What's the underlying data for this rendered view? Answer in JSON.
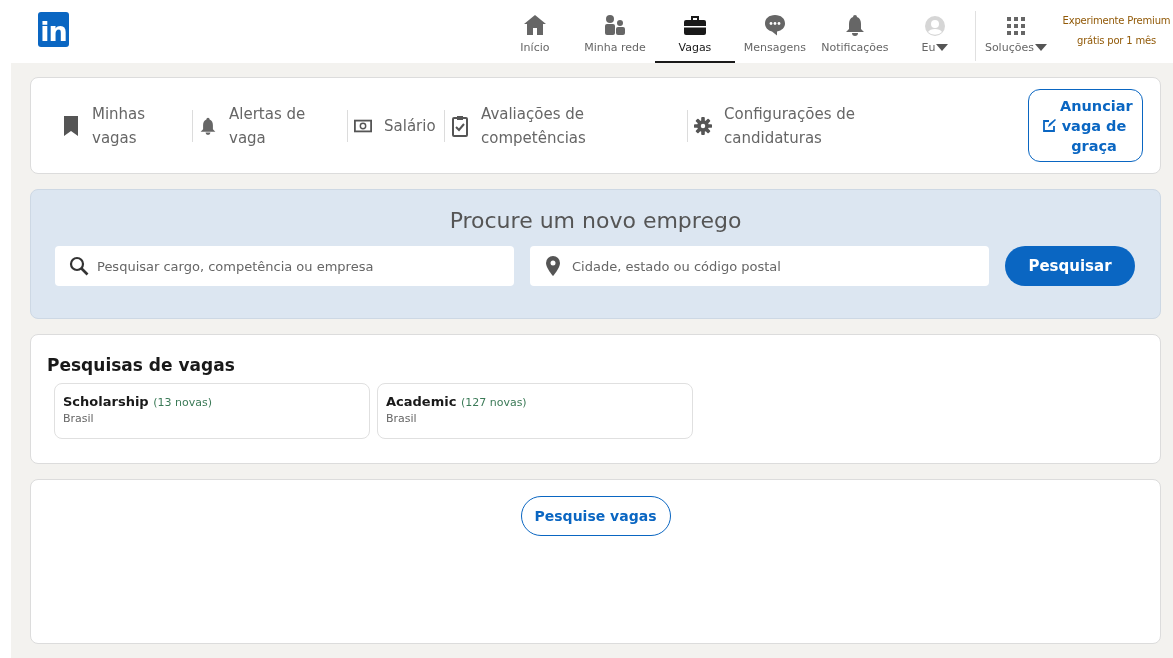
{
  "header": {
    "logo": "in",
    "nav": [
      {
        "label": "Início",
        "selected": false
      },
      {
        "label": "Minha rede",
        "selected": false
      },
      {
        "label": "Vagas",
        "selected": true
      },
      {
        "label": "Mensagens",
        "selected": false
      },
      {
        "label": "Notificações",
        "selected": false
      },
      {
        "label": "Eu",
        "selected": false,
        "dropdown": true
      },
      {
        "label": "Soluções",
        "selected": false,
        "dropdown": true
      }
    ],
    "premium": "Experimente Premium grátis por 1 mês"
  },
  "subnav": {
    "items": [
      {
        "label": "Minhas vagas"
      },
      {
        "label": "Alertas de vaga"
      },
      {
        "label": "Salário"
      },
      {
        "label": "Avaliações de competências"
      },
      {
        "label": "Configurações de candidaturas"
      }
    ],
    "post_button": "Anunciar vaga de graça"
  },
  "search": {
    "title": "Procure um novo emprego",
    "keyword_placeholder": "Pesquisar cargo, competência ou empresa",
    "location_placeholder": "Cidade, estado ou código postal",
    "button": "Pesquisar"
  },
  "saved_searches": {
    "title": "Pesquisas de vagas",
    "items": [
      {
        "query": "Scholarship",
        "count": "(13 novas)",
        "location": "Brasil"
      },
      {
        "query": "Academic",
        "count": "(127 novas)",
        "location": "Brasil"
      }
    ]
  },
  "browse_button": "Pesquise vagas"
}
